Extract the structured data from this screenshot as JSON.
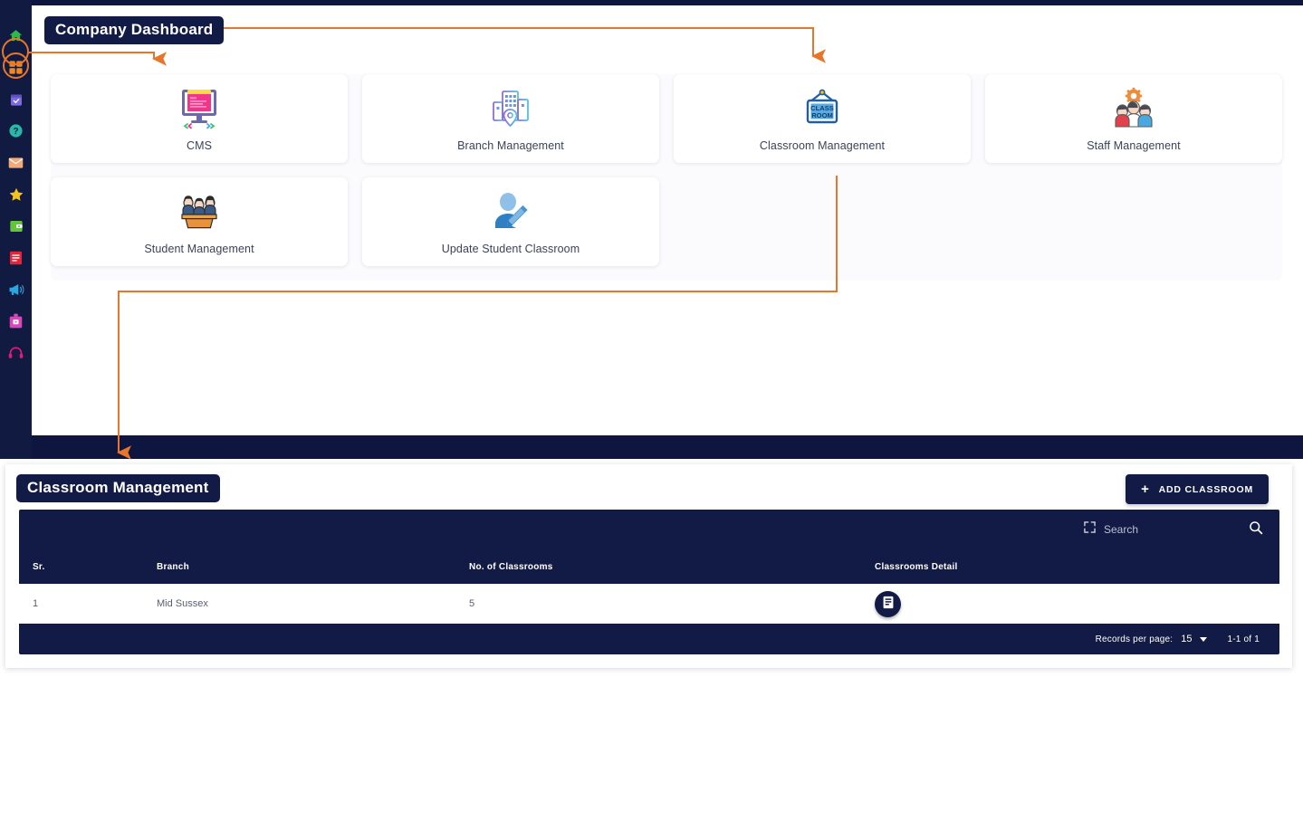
{
  "annotations": {
    "accent_color": "#e8762a",
    "company_badge": "Company Dashboard"
  },
  "sidebar": {
    "background": "#111a41",
    "items": [
      {
        "icon": "home-icon",
        "color": "#2fb84a",
        "active": false
      },
      {
        "icon": "dashboard-grid-icon",
        "color": "#f0871f",
        "active": true
      },
      {
        "icon": "calendar-check-icon",
        "color": "#7b6ae0",
        "active": false
      },
      {
        "icon": "help-circle-icon",
        "color": "#2bb6a8",
        "active": false
      },
      {
        "icon": "mail-icon",
        "color": "#f4a97a",
        "active": false
      },
      {
        "icon": "star-icon",
        "color": "#f5c21b",
        "active": false
      },
      {
        "icon": "wallet-icon",
        "color": "#64c43c",
        "active": false
      },
      {
        "icon": "document-lines-icon",
        "color": "#e3253b",
        "active": false
      },
      {
        "icon": "megaphone-icon",
        "color": "#29a7e0",
        "active": false
      },
      {
        "icon": "archive-box-icon",
        "color": "#d648b8",
        "active": false
      },
      {
        "icon": "headphones-icon",
        "color": "#e0197f",
        "active": false
      }
    ]
  },
  "dashboard": {
    "cards": [
      {
        "label": "CMS",
        "icon": "cms-monitor-icon"
      },
      {
        "label": "Branch Management",
        "icon": "branch-buildings-icon"
      },
      {
        "label": "Classroom Management",
        "icon": "classroom-sign-icon"
      },
      {
        "label": "Staff Management",
        "icon": "staff-group-gear-icon"
      },
      {
        "label": "Student Management",
        "icon": "student-desk-icon"
      },
      {
        "label": "Update Student Classroom",
        "icon": "user-edit-icon"
      }
    ]
  },
  "panel": {
    "title": "Classroom Management",
    "add_button": "ADD CLASSROOM",
    "add_button_plus": "+",
    "search": {
      "placeholder": "Search",
      "expand_icon": "expand-corners-icon",
      "search_icon": "magnifier-icon"
    },
    "table": {
      "columns": [
        "Sr.",
        "Branch",
        "No. of Classrooms",
        "Classrooms Detail"
      ],
      "rows": [
        {
          "sr": "1",
          "branch": "Mid Sussex",
          "classrooms": "5",
          "detail_icon": "document-list-icon"
        }
      ]
    },
    "footer": {
      "records_per_page_label": "Records per page:",
      "records_per_page_value": "15",
      "range_label": "1-1 of 1"
    }
  }
}
